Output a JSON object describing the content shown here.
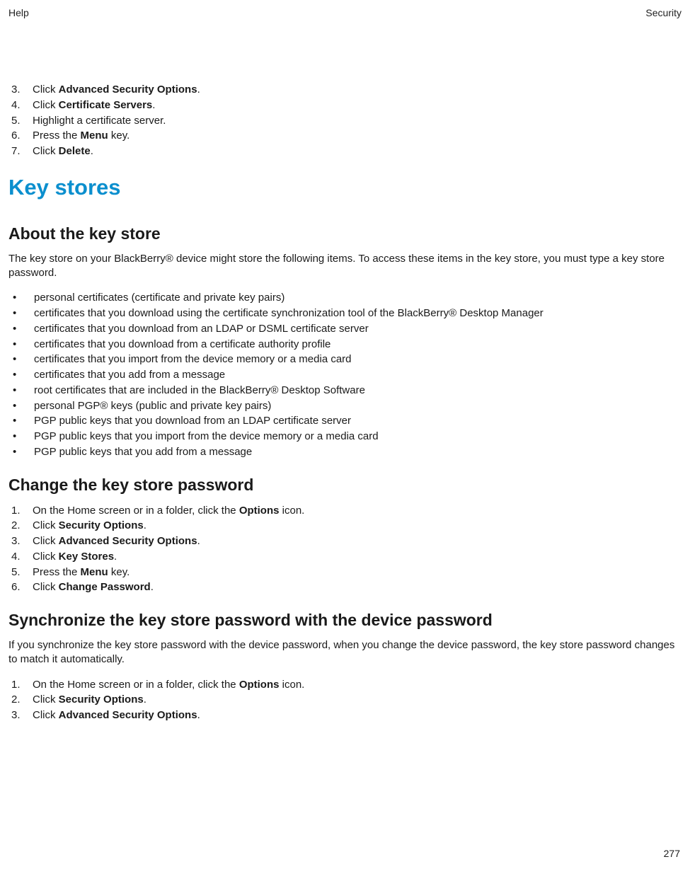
{
  "header": {
    "left": "Help",
    "right": "Security"
  },
  "top_steps": {
    "start": 3,
    "items": [
      {
        "pre": "Click ",
        "bold": "Advanced Security Options",
        "post": "."
      },
      {
        "pre": "Click ",
        "bold": "Certificate Servers",
        "post": "."
      },
      {
        "pre": "Highlight a certificate server.",
        "bold": "",
        "post": ""
      },
      {
        "pre": "Press the ",
        "bold": "Menu",
        "post": " key."
      },
      {
        "pre": "Click ",
        "bold": "Delete",
        "post": "."
      }
    ]
  },
  "h1": "Key stores",
  "about": {
    "title": "About the key store",
    "para": "The key store on your BlackBerry® device might store the following items. To access these items in the key store, you must type a key store password.",
    "bullets": [
      "personal certificates (certificate and private key pairs)",
      "certificates that you download using the certificate synchronization tool of the BlackBerry® Desktop Manager",
      "certificates that you download from an LDAP or DSML certificate server",
      "certificates that you download from a certificate authority profile",
      "certificates that you import from the device memory or a media card",
      "certificates that you add from a message",
      "root certificates that are included in the BlackBerry® Desktop Software",
      "personal PGP® keys (public and private key pairs)",
      "PGP public keys that you download from an LDAP certificate server",
      "PGP public keys that you import from the device memory or a media card",
      "PGP public keys that you add from a message"
    ]
  },
  "change": {
    "title": "Change the key store password",
    "steps": [
      {
        "pre": "On the Home screen or in a folder, click the ",
        "bold": "Options",
        "post": " icon."
      },
      {
        "pre": "Click ",
        "bold": "Security Options",
        "post": "."
      },
      {
        "pre": "Click ",
        "bold": "Advanced Security Options",
        "post": "."
      },
      {
        "pre": "Click ",
        "bold": "Key Stores",
        "post": "."
      },
      {
        "pre": "Press the ",
        "bold": "Menu",
        "post": " key."
      },
      {
        "pre": "Click ",
        "bold": "Change Password",
        "post": "."
      }
    ]
  },
  "sync": {
    "title": "Synchronize the key store password with the device password",
    "para": "If you synchronize the key store password with the device password, when you change the device password, the key store password changes to match it automatically.",
    "steps": [
      {
        "pre": "On the Home screen or in a folder, click the ",
        "bold": "Options",
        "post": " icon."
      },
      {
        "pre": "Click ",
        "bold": "Security Options",
        "post": "."
      },
      {
        "pre": "Click ",
        "bold": "Advanced Security Options",
        "post": "."
      }
    ]
  },
  "page_number": "277",
  "chart_data": null
}
